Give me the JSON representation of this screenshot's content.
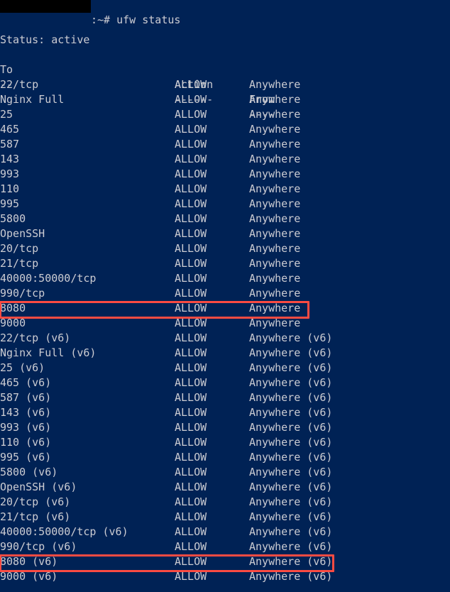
{
  "terminal": {
    "background_color": "#002255",
    "text_color": "#ccccd2",
    "highlight_color": "#fa4b42",
    "prompt_line": ":~# ufw status",
    "status_line": "Status: active",
    "blank_line": "",
    "headers": {
      "to": "To",
      "action": "Action",
      "from": "From"
    },
    "header_rules": {
      "to": "--",
      "action": "------",
      "from": "----"
    },
    "rules": [
      {
        "to": "22/tcp",
        "action": "ALLOW",
        "from": "Anywhere",
        "highlighted": false
      },
      {
        "to": "Nginx Full",
        "action": "ALLOW",
        "from": "Anywhere",
        "highlighted": false
      },
      {
        "to": "25",
        "action": "ALLOW",
        "from": "Anywhere",
        "highlighted": false
      },
      {
        "to": "465",
        "action": "ALLOW",
        "from": "Anywhere",
        "highlighted": false
      },
      {
        "to": "587",
        "action": "ALLOW",
        "from": "Anywhere",
        "highlighted": false
      },
      {
        "to": "143",
        "action": "ALLOW",
        "from": "Anywhere",
        "highlighted": false
      },
      {
        "to": "993",
        "action": "ALLOW",
        "from": "Anywhere",
        "highlighted": false
      },
      {
        "to": "110",
        "action": "ALLOW",
        "from": "Anywhere",
        "highlighted": false
      },
      {
        "to": "995",
        "action": "ALLOW",
        "from": "Anywhere",
        "highlighted": false
      },
      {
        "to": "5800",
        "action": "ALLOW",
        "from": "Anywhere",
        "highlighted": false
      },
      {
        "to": "OpenSSH",
        "action": "ALLOW",
        "from": "Anywhere",
        "highlighted": false
      },
      {
        "to": "20/tcp",
        "action": "ALLOW",
        "from": "Anywhere",
        "highlighted": false
      },
      {
        "to": "21/tcp",
        "action": "ALLOW",
        "from": "Anywhere",
        "highlighted": false
      },
      {
        "to": "40000:50000/tcp",
        "action": "ALLOW",
        "from": "Anywhere",
        "highlighted": false
      },
      {
        "to": "990/tcp",
        "action": "ALLOW",
        "from": "Anywhere",
        "highlighted": false
      },
      {
        "to": "8080",
        "action": "ALLOW",
        "from": "Anywhere",
        "highlighted": true
      },
      {
        "to": "9000",
        "action": "ALLOW",
        "from": "Anywhere",
        "highlighted": false
      },
      {
        "to": "22/tcp (v6)",
        "action": "ALLOW",
        "from": "Anywhere (v6)",
        "highlighted": false
      },
      {
        "to": "Nginx Full (v6)",
        "action": "ALLOW",
        "from": "Anywhere (v6)",
        "highlighted": false
      },
      {
        "to": "25 (v6)",
        "action": "ALLOW",
        "from": "Anywhere (v6)",
        "highlighted": false
      },
      {
        "to": "465 (v6)",
        "action": "ALLOW",
        "from": "Anywhere (v6)",
        "highlighted": false
      },
      {
        "to": "587 (v6)",
        "action": "ALLOW",
        "from": "Anywhere (v6)",
        "highlighted": false
      },
      {
        "to": "143 (v6)",
        "action": "ALLOW",
        "from": "Anywhere (v6)",
        "highlighted": false
      },
      {
        "to": "993 (v6)",
        "action": "ALLOW",
        "from": "Anywhere (v6)",
        "highlighted": false
      },
      {
        "to": "110 (v6)",
        "action": "ALLOW",
        "from": "Anywhere (v6)",
        "highlighted": false
      },
      {
        "to": "995 (v6)",
        "action": "ALLOW",
        "from": "Anywhere (v6)",
        "highlighted": false
      },
      {
        "to": "5800 (v6)",
        "action": "ALLOW",
        "from": "Anywhere (v6)",
        "highlighted": false
      },
      {
        "to": "OpenSSH (v6)",
        "action": "ALLOW",
        "from": "Anywhere (v6)",
        "highlighted": false
      },
      {
        "to": "20/tcp (v6)",
        "action": "ALLOW",
        "from": "Anywhere (v6)",
        "highlighted": false
      },
      {
        "to": "21/tcp (v6)",
        "action": "ALLOW",
        "from": "Anywhere (v6)",
        "highlighted": false
      },
      {
        "to": "40000:50000/tcp (v6)",
        "action": "ALLOW",
        "from": "Anywhere (v6)",
        "highlighted": false
      },
      {
        "to": "990/tcp (v6)",
        "action": "ALLOW",
        "from": "Anywhere (v6)",
        "highlighted": false
      },
      {
        "to": "8080 (v6)",
        "action": "ALLOW",
        "from": "Anywhere (v6)",
        "highlighted": true
      },
      {
        "to": "9000 (v6)",
        "action": "ALLOW",
        "from": "Anywhere (v6)",
        "highlighted": false
      }
    ]
  }
}
